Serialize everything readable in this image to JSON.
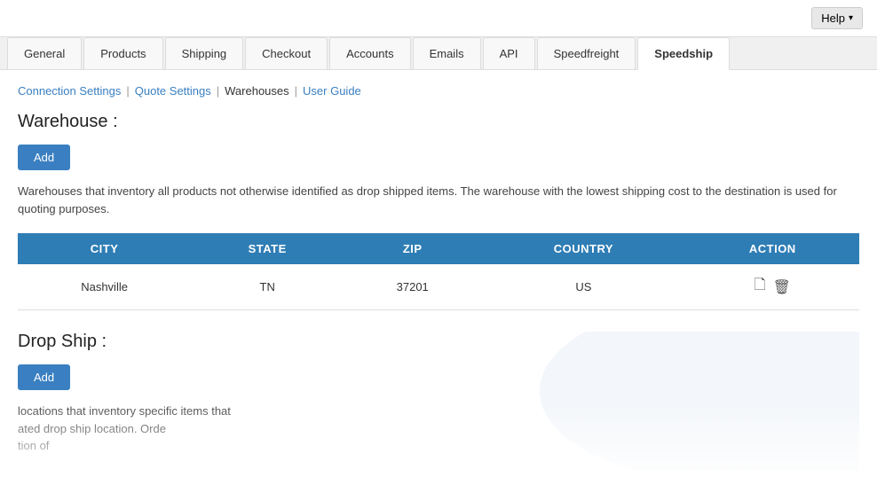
{
  "topbar": {
    "help_label": "Help"
  },
  "tabs": {
    "items": [
      {
        "id": "general",
        "label": "General",
        "active": false
      },
      {
        "id": "products",
        "label": "Products",
        "active": false
      },
      {
        "id": "shipping",
        "label": "Shipping",
        "active": false
      },
      {
        "id": "checkout",
        "label": "Checkout",
        "active": false
      },
      {
        "id": "accounts",
        "label": "Accounts",
        "active": false
      },
      {
        "id": "emails",
        "label": "Emails",
        "active": false
      },
      {
        "id": "api",
        "label": "API",
        "active": false
      },
      {
        "id": "speedfreight",
        "label": "Speedfreight",
        "active": false
      },
      {
        "id": "speedship",
        "label": "Speedship",
        "active": true
      }
    ]
  },
  "subnav": {
    "items": [
      {
        "id": "connection-settings",
        "label": "Connection Settings",
        "active": false
      },
      {
        "id": "quote-settings",
        "label": "Quote Settings",
        "active": false
      },
      {
        "id": "warehouses",
        "label": "Warehouses",
        "active": true
      },
      {
        "id": "user-guide",
        "label": "User Guide",
        "active": false
      }
    ]
  },
  "warehouse": {
    "title": "Warehouse :",
    "add_label": "Add",
    "description": "Warehouses that inventory all products not otherwise identified as drop shipped items. The warehouse with the lowest shipping cost to the destination is used for quoting purposes.",
    "table": {
      "columns": [
        "CITY",
        "STATE",
        "ZIP",
        "COUNTRY",
        "ACTION"
      ],
      "rows": [
        {
          "city": "Nashville",
          "state": "TN",
          "zip": "37201",
          "country": "US"
        }
      ]
    }
  },
  "dropship": {
    "title": "Drop Ship :",
    "add_label": "Add",
    "description_line1": "locations that inventory specific items that",
    "description_line2": "ated drop ship location. Orde",
    "description_line3": "tion of"
  }
}
